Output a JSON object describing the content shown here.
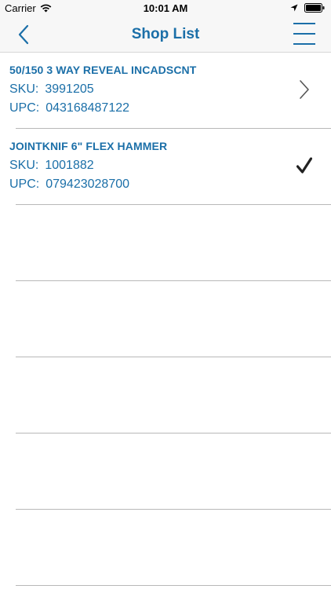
{
  "status_bar": {
    "carrier": "Carrier",
    "time": "10:01 AM"
  },
  "nav": {
    "title": "Shop List"
  },
  "items": [
    {
      "title": "50/150 3 WAY REVEAL INCADSCNT",
      "sku_label": "SKU:",
      "sku": "3991205",
      "upc_label": "UPC:",
      "upc": "043168487122",
      "accessory": "chevron-right-icon"
    },
    {
      "title": "JOINTKNIF 6\" FLEX HAMMER",
      "sku_label": "SKU:",
      "sku": "1001882",
      "upc_label": "UPC:",
      "upc": "079423028700",
      "accessory": "checkmark-icon"
    }
  ],
  "colors": {
    "accent": "#1b6fa8",
    "separator": "#b8b8b8",
    "bar_bg": "#f7f7f7"
  }
}
